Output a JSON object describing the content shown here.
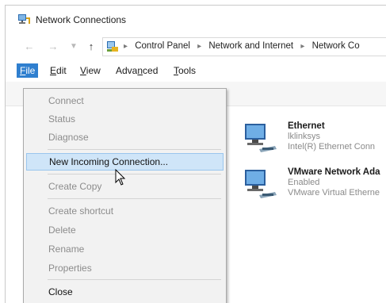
{
  "window": {
    "title": "Network Connections"
  },
  "nav": {
    "back_icon": "back-arrow-icon",
    "forward_icon": "forward-arrow-icon",
    "up_icon": "up-arrow-icon",
    "breadcrumbs": [
      "Control Panel",
      "Network and Internet",
      "Network Co"
    ]
  },
  "menubar": {
    "items": [
      "File",
      "Edit",
      "View",
      "Advanced",
      "Tools"
    ],
    "active": "File"
  },
  "file_menu": {
    "items": [
      {
        "label": "Connect",
        "enabled": false
      },
      {
        "label": "Status",
        "enabled": false
      },
      {
        "label": "Diagnose",
        "enabled": false
      },
      {
        "label": "New Incoming Connection...",
        "enabled": true,
        "highlighted": true
      },
      {
        "label": "Create Copy",
        "enabled": false
      },
      {
        "label": "Create shortcut",
        "enabled": false
      },
      {
        "label": "Delete",
        "enabled": false
      },
      {
        "label": "Rename",
        "enabled": false
      },
      {
        "label": "Properties",
        "enabled": false
      },
      {
        "label": "Close",
        "enabled": true
      }
    ]
  },
  "connections": [
    {
      "name": "Ethernet",
      "status": "lklinksys",
      "device": "Intel(R) Ethernet Conn"
    },
    {
      "name": "VMware Network Ada",
      "status": "Enabled",
      "device": "VMware Virtual Etherne"
    }
  ],
  "colors": {
    "menu_active": "#2f7fcf",
    "highlight": "#cfe5f8"
  }
}
